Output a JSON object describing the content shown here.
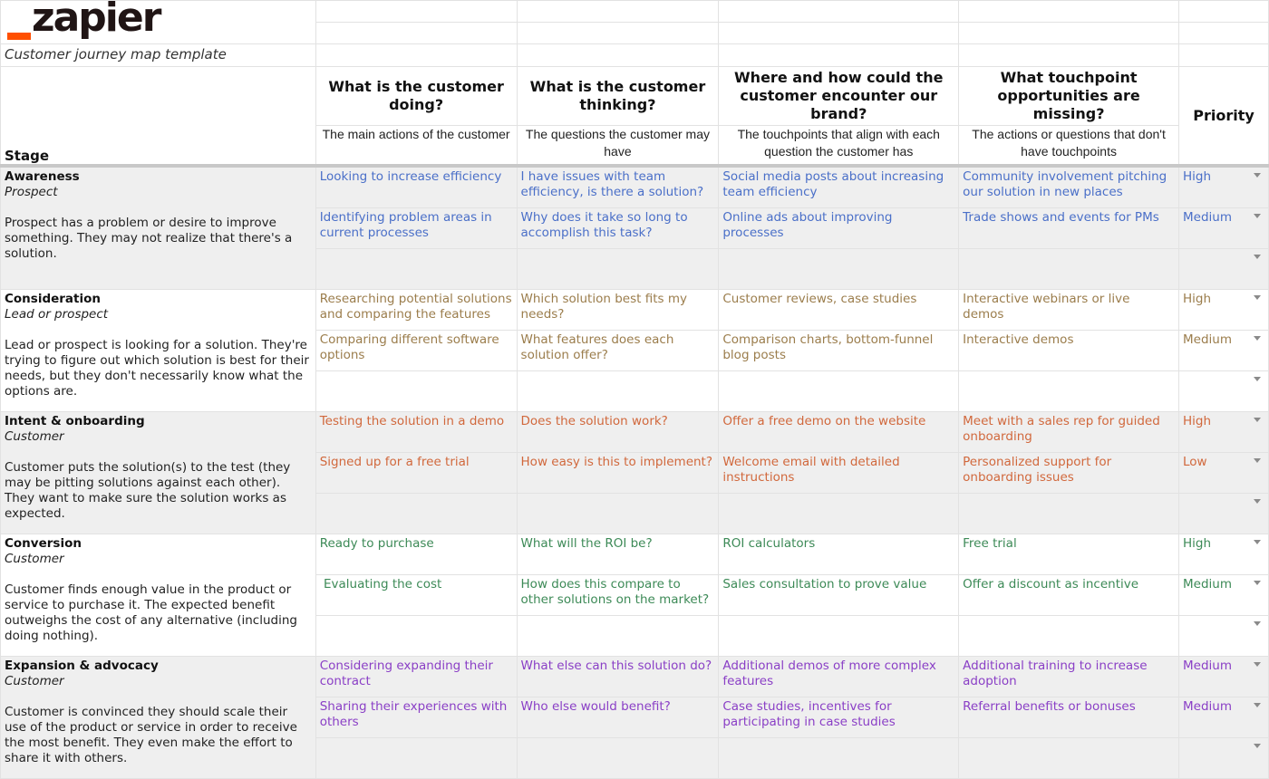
{
  "logo": {
    "text": "zapier",
    "accent_color": "#ff4f00"
  },
  "subtitle": "Customer journey map template",
  "columns": [
    {
      "title": "",
      "description": ""
    },
    {
      "title": "What is the customer doing?",
      "description": "The main actions of the customer"
    },
    {
      "title": "What is the customer thinking?",
      "description": "The questions the customer may have"
    },
    {
      "title": "Where and how could the customer encounter our brand?",
      "description": "The touchpoints that align with each question the customer has"
    },
    {
      "title": "What touchpoint opportunities are missing?",
      "description": "The actions or questions that don't have touchpoints"
    },
    {
      "title": "Priority",
      "description": ""
    }
  ],
  "stage_header": "Stage",
  "stages": [
    {
      "name": "Awareness",
      "role": "Prospect",
      "description": "Prospect has a problem or desire to improve something. They may not realize that there's a solution.",
      "color": "#4a6fc8",
      "rows": [
        {
          "doing": "Looking to increase efficiency",
          "thinking": "I have issues with team efficiency, is there a solution?",
          "encounter": "Social media posts about increasing team efficiency",
          "missing": "Community involvement pitching our solution in new places",
          "priority": "High"
        },
        {
          "doing": "Identifying problem areas in current processes",
          "thinking": "Why does it take so long to accomplish this task?",
          "encounter": "Online ads about improving processes",
          "missing": "Trade shows and events for PMs",
          "priority": "Medium"
        },
        {
          "doing": "",
          "thinking": "",
          "encounter": "",
          "missing": "",
          "priority": ""
        }
      ]
    },
    {
      "name": "Consideration",
      "role": "Lead or prospect",
      "description": "Lead or prospect is looking for a solution. They're trying to figure out which solution is best for their needs, but they don't necessarily know what the options are.",
      "color": "#9b7d4c",
      "rows": [
        {
          "doing": "Researching potential solutions and comparing the features",
          "thinking": "Which solution best fits my needs?",
          "encounter": "Customer reviews, case studies",
          "missing": "Interactive webinars or live demos",
          "priority": "High"
        },
        {
          "doing": "Comparing different software options",
          "thinking": "What features does each solution offer?",
          "encounter": "Comparison charts, bottom-funnel blog posts",
          "missing": "Interactive demos",
          "priority": "Medium"
        },
        {
          "doing": "",
          "thinking": "",
          "encounter": "",
          "missing": "",
          "priority": ""
        }
      ]
    },
    {
      "name": "Intent & onboarding",
      "role": "Customer",
      "description": "Customer puts the solution(s) to the test (they may be pitting solutions against each other). They want to make sure the solution works as expected.",
      "color": "#d1683c",
      "rows": [
        {
          "doing": "Testing the solution in a demo",
          "thinking": "Does the solution work?",
          "encounter": "Offer a free demo on the website",
          "missing": "Meet with a sales rep for guided onboarding",
          "priority": "High"
        },
        {
          "doing": "Signed up for a free trial",
          "thinking": "How easy is this to implement?",
          "encounter": "Welcome email with detailed instructions",
          "missing": "Personalized support for onboarding issues",
          "priority": "Low"
        },
        {
          "doing": "",
          "thinking": "",
          "encounter": "",
          "missing": "",
          "priority": ""
        }
      ]
    },
    {
      "name": "Conversion",
      "role": "Customer",
      "description": "Customer finds enough value in the product or service to purchase it. The expected benefit outweighs the cost of any alternative (including doing nothing).",
      "color": "#3d8a57",
      "rows": [
        {
          "doing": "Ready to purchase",
          "thinking": "What will the ROI be?",
          "encounter": "ROI calculators",
          "missing": "Free trial",
          "priority": "High"
        },
        {
          "doing": " Evaluating the cost",
          "thinking": "How does this compare to other solutions on the market?",
          "encounter": "Sales consultation to prove value",
          "missing": "Offer a discount as incentive",
          "priority": "Medium"
        },
        {
          "doing": "",
          "thinking": "",
          "encounter": "",
          "missing": "",
          "priority": ""
        }
      ]
    },
    {
      "name": "Expansion & advocacy",
      "role": "Customer",
      "description": "Customer is convinced they should scale their use of the product or service in order to receive the most benefit. They even make the effort to share it with others.",
      "color": "#8a3fc6",
      "rows": [
        {
          "doing": "Considering expanding their contract",
          "thinking": "What else can this solution do?",
          "encounter": "Additional demos of more complex features",
          "missing": "Additional training to increase adoption",
          "priority": "Medium"
        },
        {
          "doing": "Sharing their experiences with others",
          "thinking": "Who else would benefit?",
          "encounter": "Case studies, incentives for participating in case studies",
          "missing": "Referral benefits or bonuses",
          "priority": "Medium"
        },
        {
          "doing": "",
          "thinking": "",
          "encounter": "",
          "missing": "",
          "priority": ""
        }
      ]
    }
  ]
}
